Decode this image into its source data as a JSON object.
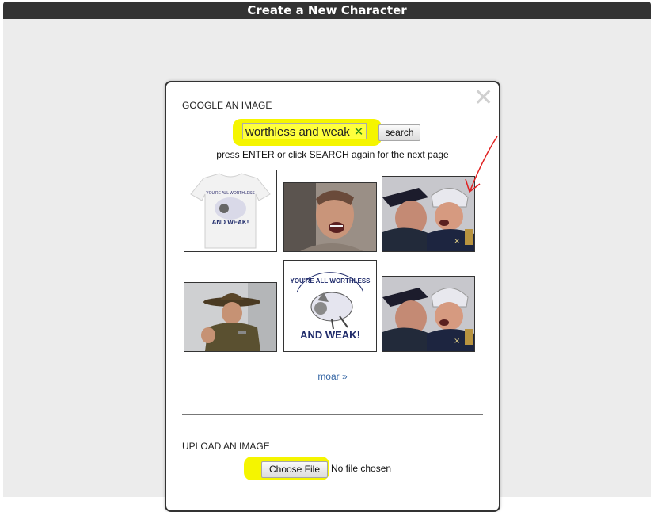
{
  "header": {
    "title": "Create a New Character"
  },
  "dialog": {
    "close_icon": "close-icon",
    "google_section": {
      "title": "GOOGLE AN IMAGE",
      "search_value": "worthless and weak",
      "clear_icon": "clear-x-icon",
      "search_button": "search",
      "hint": "press ENTER or click SEARCH again for the next page",
      "thumbnails": [
        {
          "description": "t-shirt print",
          "caption_lines": [
            "YOU'RE ALL WORTHLESS",
            "AND WEAK!"
          ]
        },
        {
          "description": "man shouting"
        },
        {
          "description": "two men in uniforms"
        },
        {
          "description": "drill sergeant pointing"
        },
        {
          "description": "cartoon print",
          "caption_lines": [
            "YOU'RE ALL WORTHLESS",
            "AND WEAK!"
          ]
        },
        {
          "description": "two men in uniforms"
        }
      ],
      "more_link": "moar »"
    },
    "upload_section": {
      "title": "UPLOAD AN IMAGE",
      "choose_button": "Choose File",
      "file_status": "No file chosen"
    }
  },
  "colors": {
    "highlight": "#f5f500",
    "annotation_arrow": "#e02020",
    "link": "#3465a4"
  }
}
